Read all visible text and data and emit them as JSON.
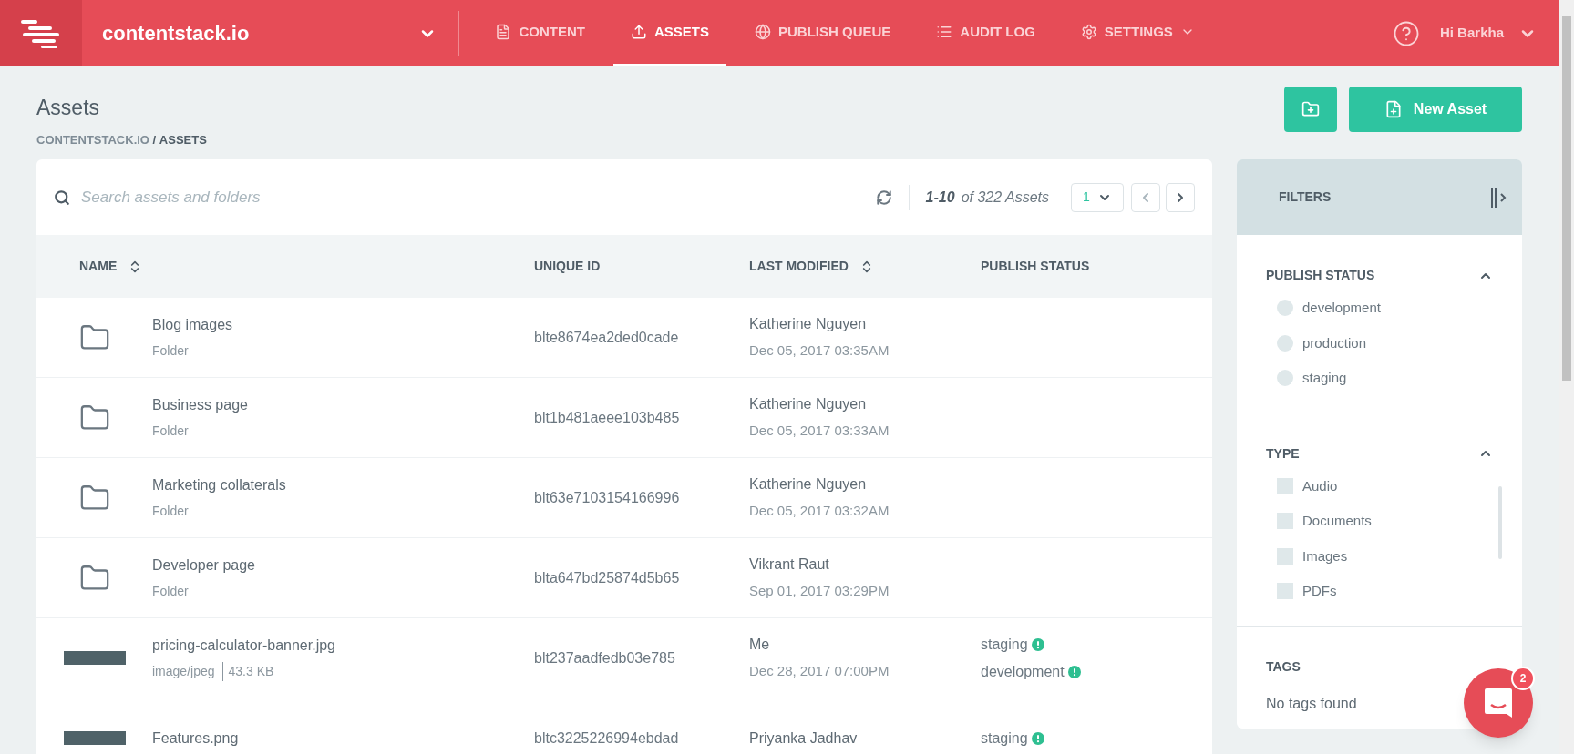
{
  "topbar": {
    "brand": "contentstack.io",
    "nav": [
      {
        "label": "CONTENT",
        "selected": false,
        "has_menu": false
      },
      {
        "label": "ASSETS",
        "selected": true,
        "has_menu": false
      },
      {
        "label": "PUBLISH QUEUE",
        "selected": false,
        "has_menu": false
      },
      {
        "label": "AUDIT LOG",
        "selected": false,
        "has_menu": false
      },
      {
        "label": "SETTINGS",
        "selected": false,
        "has_menu": true
      }
    ],
    "greeting": "Hi Barkha"
  },
  "header": {
    "title": "Assets",
    "separator": "/",
    "breadcrumb": [
      {
        "label": "CONTENTSTACK.IO",
        "current": false
      },
      {
        "label": "ASSETS",
        "current": true
      }
    ],
    "new_button": "New Asset"
  },
  "toolbar": {
    "search_placeholder": "Search assets and folders",
    "range": "1-10",
    "total": "of 322 Assets",
    "page": "1"
  },
  "table": {
    "columns": [
      {
        "label": "NAME",
        "sortable": true
      },
      {
        "label": "UNIQUE ID",
        "sortable": false
      },
      {
        "label": "LAST MODIFIED",
        "sortable": true
      },
      {
        "label": "PUBLISH STATUS",
        "sortable": false
      }
    ],
    "rows": [
      {
        "kind": "folder",
        "name": "Blog images",
        "type": "Folder",
        "uid": "blte8674ea2ded0cade",
        "user": "Katherine Nguyen",
        "date": "Dec 05, 2017 03:35AM",
        "statuses": []
      },
      {
        "kind": "folder",
        "name": "Business page",
        "type": "Folder",
        "uid": "blt1b481aeee103b485",
        "user": "Katherine Nguyen",
        "date": "Dec 05, 2017 03:33AM",
        "statuses": []
      },
      {
        "kind": "folder",
        "name": "Marketing collaterals",
        "type": "Folder",
        "uid": "blt63e7103154166996",
        "user": "Katherine Nguyen",
        "date": "Dec 05, 2017 03:32AM",
        "statuses": []
      },
      {
        "kind": "folder",
        "name": "Developer page",
        "type": "Folder",
        "uid": "blta647bd25874d5b65",
        "user": "Vikrant Raut",
        "date": "Sep 01, 2017 03:29PM",
        "statuses": []
      },
      {
        "kind": "image",
        "name": "pricing-calculator-banner.jpg",
        "type": "image/jpeg",
        "size": "43.3 KB",
        "uid": "blt237aadfedb03e785",
        "user": "Me",
        "date": "Dec 28, 2017 07:00PM",
        "statuses": [
          "staging",
          "development"
        ]
      },
      {
        "kind": "image",
        "name": "Features.png",
        "uid": "bltc3225226994ebdad",
        "user": "Priyanka Jadhav",
        "statuses": [
          "staging"
        ]
      }
    ]
  },
  "filters": {
    "title": "FILTERS",
    "sections": [
      {
        "kind": "radio",
        "title": "PUBLISH STATUS",
        "expanded": true,
        "items": [
          {
            "label": "development",
            "checked": false
          },
          {
            "label": "production",
            "checked": false
          },
          {
            "label": "staging",
            "checked": false
          }
        ]
      },
      {
        "kind": "checkbox",
        "title": "TYPE",
        "expanded": true,
        "items": [
          {
            "label": "Audio",
            "checked": false
          },
          {
            "label": "Documents",
            "checked": false
          },
          {
            "label": "Images",
            "checked": false
          },
          {
            "label": "PDFs",
            "checked": false
          }
        ]
      },
      {
        "kind": "text",
        "title": "TAGS",
        "text": "No tags found"
      }
    ]
  },
  "chat": {
    "badge": "2"
  }
}
